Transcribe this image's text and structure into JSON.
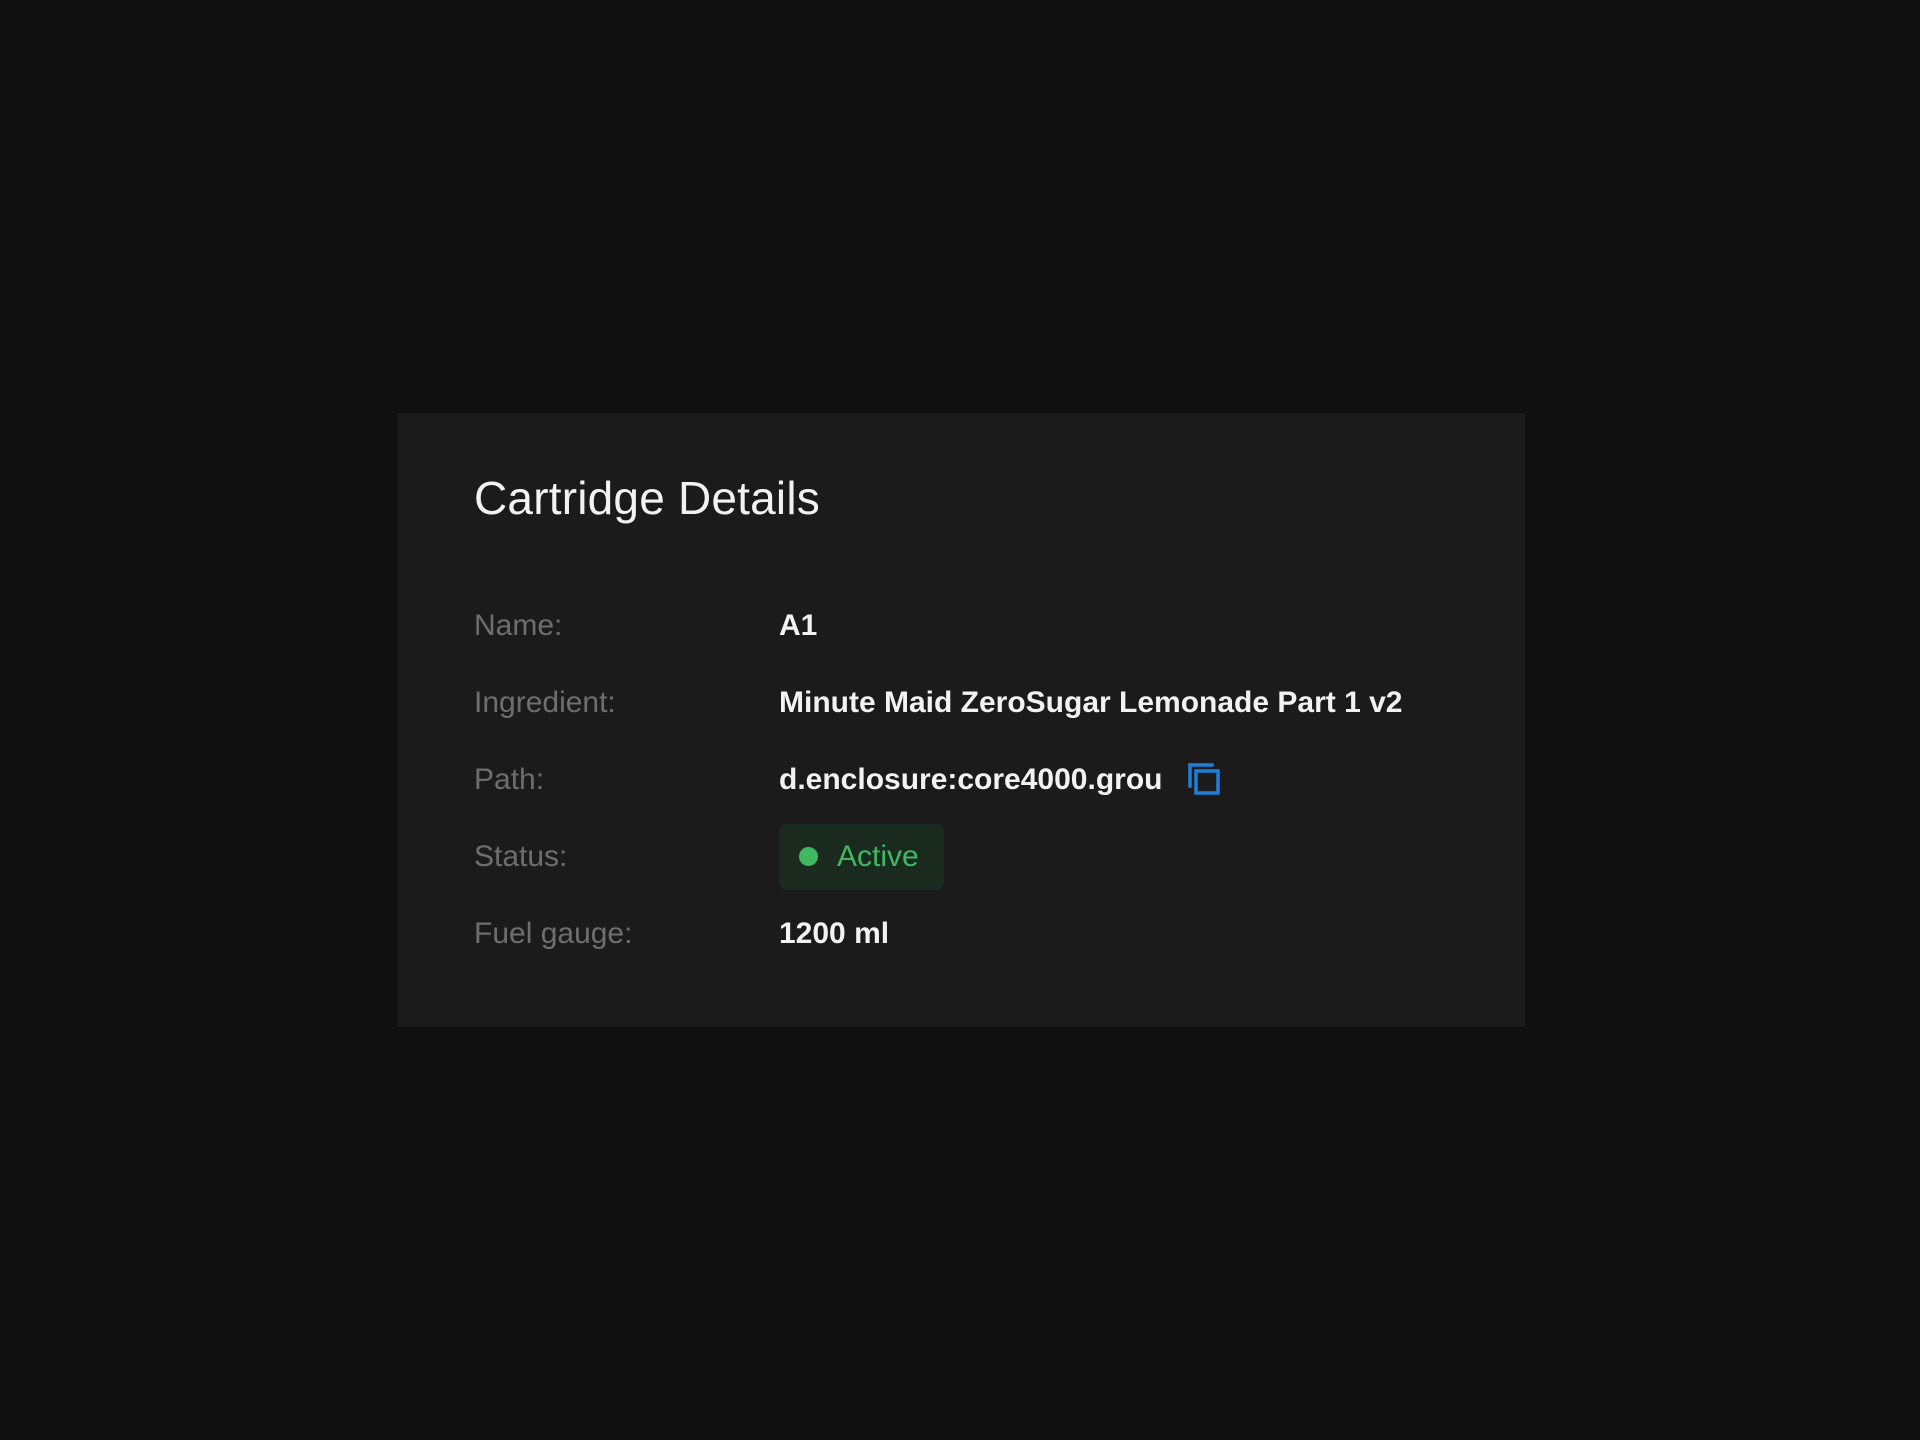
{
  "card": {
    "title": "Cartridge Details",
    "rows": {
      "name": {
        "label": "Name:",
        "value": "A1"
      },
      "ingredient": {
        "label": "Ingredient:",
        "value": "Minute Maid ZeroSugar Lemonade Part 1 v2"
      },
      "path": {
        "label": "Path:",
        "value": "d.enclosure:core4000.grou",
        "copy_icon": "copy-icon"
      },
      "status": {
        "label": "Status:",
        "value": "Active",
        "color": "#3fb861"
      },
      "fuel_gauge": {
        "label": "Fuel gauge:",
        "value": "1200 ml"
      }
    }
  },
  "colors": {
    "page_background": "#101010",
    "card_background": "#1b1b1b",
    "label": "#6e6e6e",
    "value": "#f2f2f2",
    "accent_blue": "#1e7fd8",
    "status_green": "#3fb861"
  }
}
